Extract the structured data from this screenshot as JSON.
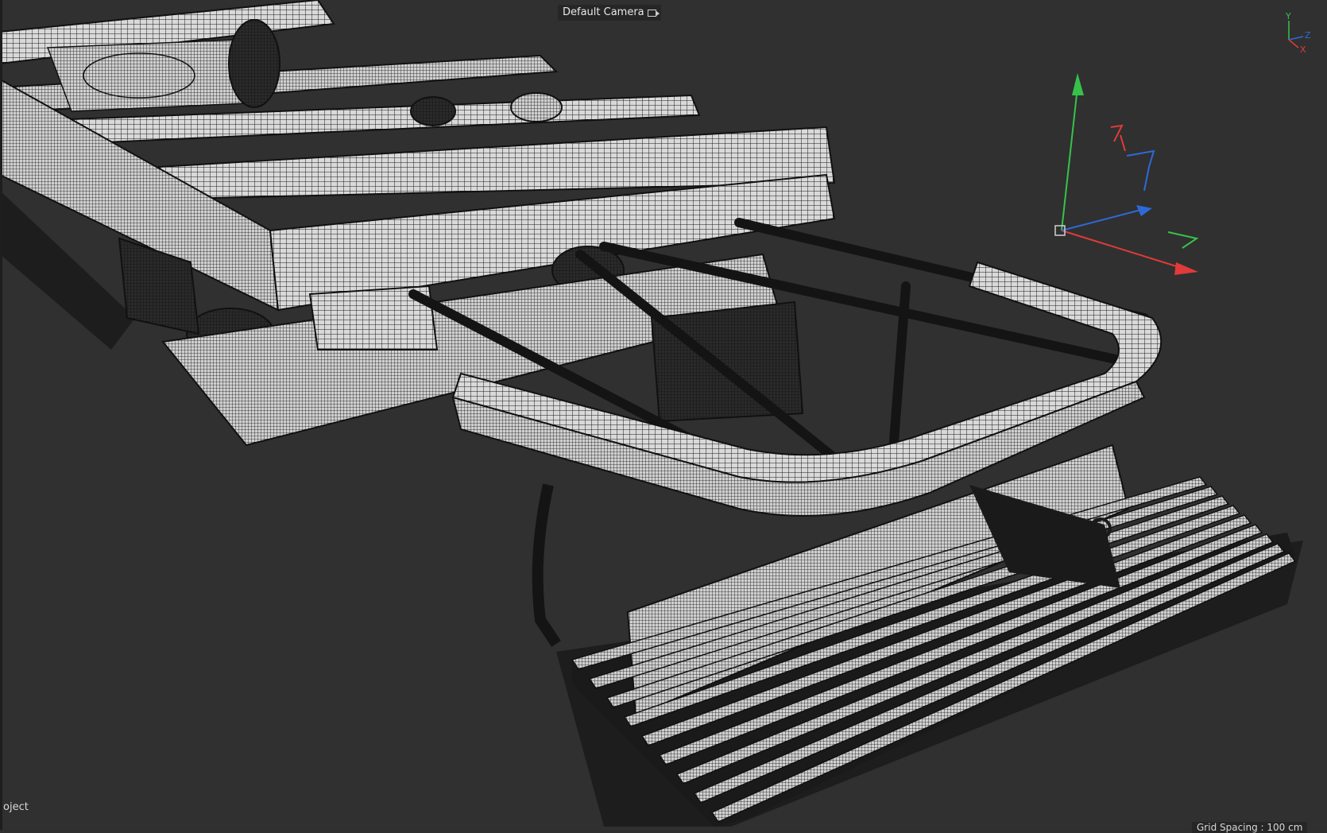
{
  "viewport": {
    "camera_label": "Default Camera",
    "object_label": "oject",
    "grid_spacing": "Grid Spacing : 100 cm"
  },
  "axis_indicator": {
    "labels": [
      "Y",
      "Z",
      "X"
    ],
    "colors": {
      "x": "#e03a3a",
      "y": "#36c24a",
      "z": "#2d6ad8"
    }
  },
  "colors": {
    "background": "#303030",
    "wire": "#1a1a1a",
    "surface": "#cfcfcf"
  }
}
